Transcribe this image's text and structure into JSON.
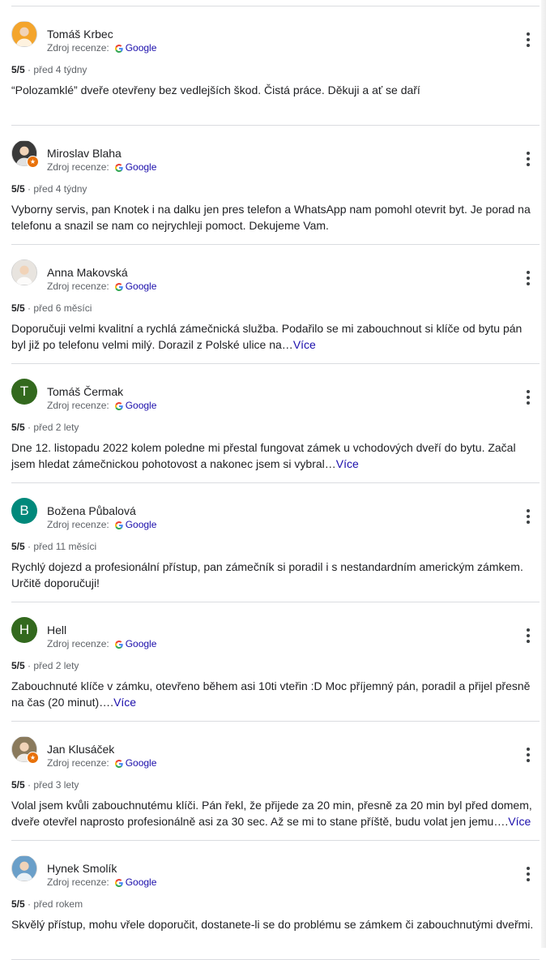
{
  "reviews": [
    {
      "author": "Tomáš Krbec",
      "avatar": {
        "type": "photo",
        "icon": "user-photo-icon",
        "bg": "#f4a52c",
        "local_guide": false
      },
      "source_label": "Zdroj recenze:",
      "source_name": "Google",
      "score": "5/5",
      "date": "před 4 týdny",
      "text": "“Polozamklé” dveře otevřeny bez vedlejších škod. Čistá práce. Děkuji a ať se daří",
      "more": ""
    },
    {
      "author": "Miroslav Blaha",
      "avatar": {
        "type": "photo",
        "icon": "user-photo-icon",
        "bg": "#3a3a3a",
        "local_guide": true
      },
      "source_label": "Zdroj recenze:",
      "source_name": "Google",
      "score": "5/5",
      "date": "před 4 týdny",
      "text": "Vyborny servis, pan Knotek i na dalku jen pres telefon a WhatsApp nam pomohl otevrit byt. Je porad na telefonu a snazil se nam co nejrychleji pomoct. Dekujeme Vam.",
      "more": ""
    },
    {
      "author": "Anna Makovská",
      "avatar": {
        "type": "photo",
        "icon": "user-photo-icon",
        "bg": "#e8e4df",
        "local_guide": false
      },
      "source_label": "Zdroj recenze:",
      "source_name": "Google",
      "score": "5/5",
      "date": "před 6 měsíci",
      "text": "Doporučuji velmi kvalitní a rychlá zámečnická služba. Podařilo se mi zabouchnout si klíče od bytu pán byl již po telefonu velmi milý. Dorazil z Polské ulice na…",
      "more": "Více"
    },
    {
      "author": "Tomáš Čermak",
      "avatar": {
        "type": "letter",
        "letter": "T",
        "bg": "#33691e",
        "local_guide": false
      },
      "source_label": "Zdroj recenze:",
      "source_name": "Google",
      "score": "5/5",
      "date": "před 2 lety",
      "text": "Dne 12. listopadu 2022 kolem poledne mi přestal fungovat zámek u vchodových dveří do bytu. Začal jsem hledat zámečnickou pohotovost a nakonec jsem si vybral…",
      "more": "Více"
    },
    {
      "author": "Božena Půbalová",
      "avatar": {
        "type": "letter",
        "letter": "B",
        "bg": "#00897b",
        "local_guide": false
      },
      "source_label": "Zdroj recenze:",
      "source_name": "Google",
      "score": "5/5",
      "date": "před 11 měsíci",
      "text": "Rychlý dojezd a profesionální přístup, pan zámečník si poradil i s nestandardním americkým zámkem. Určitě doporučuji!",
      "more": ""
    },
    {
      "author": "Hell",
      "avatar": {
        "type": "letter",
        "letter": "H",
        "bg": "#33691e",
        "local_guide": false
      },
      "source_label": "Zdroj recenze:",
      "source_name": "Google",
      "score": "5/5",
      "date": "před 2 lety",
      "text": "Zabouchnuté klíče v zámku, otevřeno během asi 10ti vteřin :D Moc příjemný pán, poradil a přijel přesně na čas (20 minut)….",
      "more": "Více"
    },
    {
      "author": "Jan Klusáček",
      "avatar": {
        "type": "photo",
        "icon": "user-photo-icon",
        "bg": "#8a7a5c",
        "local_guide": true
      },
      "source_label": "Zdroj recenze:",
      "source_name": "Google",
      "score": "5/5",
      "date": "před 3 lety",
      "text": "Volal jsem kvůli zabouchnutému klíči. Pán řekl, že přijede za 20 min, přesně za 20 min byl před domem, dveře otevřel naprosto profesionálně asi za 30 sec. Až se mi to stane příště, budu volat jen jemu….",
      "more": "Více"
    },
    {
      "author": "Hynek Smolík",
      "avatar": {
        "type": "photo",
        "icon": "user-photo-icon",
        "bg": "#6a9fc9",
        "local_guide": false
      },
      "source_label": "Zdroj recenze:",
      "source_name": "Google",
      "score": "5/5",
      "date": "před rokem",
      "text": "Skvělý přístup, mohu vřele doporučit, dostanete-li se do problému se zámkem či zabouchnutými dveřmi.",
      "more": ""
    }
  ],
  "icons": {
    "more": "more-vert-icon",
    "google": "google-g-icon",
    "local_guide": "local-guide-badge-icon"
  },
  "colors": {
    "link": "#1a0dab",
    "divider": "#dadce0"
  }
}
